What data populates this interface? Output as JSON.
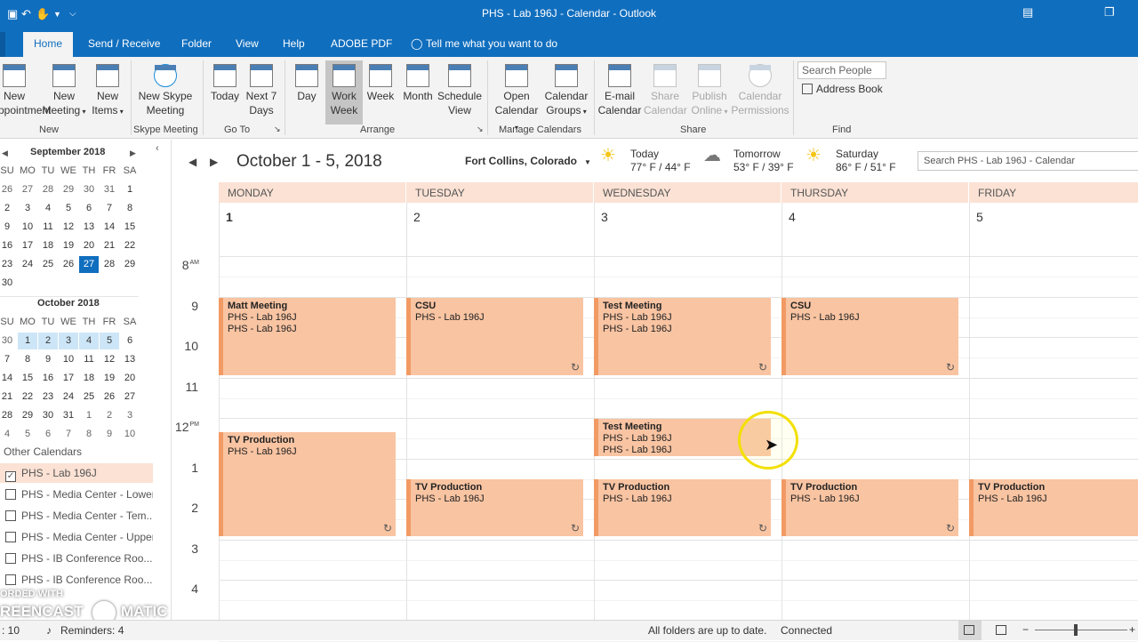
{
  "window": {
    "title": "PHS - Lab 196J - Calendar  -  Outlook"
  },
  "ribbon_tabs": [
    "Home",
    "Send / Receive",
    "Folder",
    "View",
    "Help",
    "ADOBE PDF"
  ],
  "tell_me": "Tell me what you want to do",
  "ribbon": {
    "new_appointment": [
      "New",
      "Appointment"
    ],
    "new_meeting": [
      "New",
      "Meeting"
    ],
    "new_items": [
      "New",
      "Items"
    ],
    "skype": [
      "New Skype",
      "Meeting"
    ],
    "today": "Today",
    "next7": [
      "Next 7",
      "Days"
    ],
    "day": "Day",
    "work_week": [
      "Work",
      "Week"
    ],
    "week": "Week",
    "month": "Month",
    "schedule": [
      "Schedule",
      "View"
    ],
    "open_calendar": [
      "Open",
      "Calendar"
    ],
    "calendar_groups": [
      "Calendar",
      "Groups"
    ],
    "email_calendar": [
      "E-mail",
      "Calendar"
    ],
    "share_calendar": [
      "Share",
      "Calendar"
    ],
    "publish_online": [
      "Publish",
      "Online"
    ],
    "calendar_permissions": [
      "Calendar",
      "Permissions"
    ],
    "search_people": "Search People",
    "address_book": "Address Book",
    "groups": {
      "new": "New",
      "skype": "Skype Meeting",
      "goto": "Go To",
      "arrange": "Arrange",
      "manage": "Manage Calendars",
      "share": "Share",
      "find": "Find"
    }
  },
  "mini_calendars": [
    {
      "title": "September 2018",
      "dow": [
        "SU",
        "MO",
        "TU",
        "WE",
        "TH",
        "FR",
        "SA"
      ],
      "weeks": [
        [
          "26",
          "27",
          "28",
          "29",
          "30",
          "31",
          "1"
        ],
        [
          "2",
          "3",
          "4",
          "5",
          "6",
          "7",
          "8"
        ],
        [
          "9",
          "10",
          "11",
          "12",
          "13",
          "14",
          "15"
        ],
        [
          "16",
          "17",
          "18",
          "19",
          "20",
          "21",
          "22"
        ],
        [
          "23",
          "24",
          "25",
          "26",
          "27",
          "28",
          "29"
        ],
        [
          "30"
        ]
      ]
    },
    {
      "title": "October 2018",
      "dow": [
        "SU",
        "MO",
        "TU",
        "WE",
        "TH",
        "FR",
        "SA"
      ],
      "weeks": [
        [
          "30",
          "1",
          "2",
          "3",
          "4",
          "5",
          "6"
        ],
        [
          "7",
          "8",
          "9",
          "10",
          "11",
          "12",
          "13"
        ],
        [
          "14",
          "15",
          "16",
          "17",
          "18",
          "19",
          "20"
        ],
        [
          "21",
          "22",
          "23",
          "24",
          "25",
          "26",
          "27"
        ],
        [
          "28",
          "29",
          "30",
          "31",
          "1",
          "2",
          "3"
        ],
        [
          "4",
          "5",
          "6",
          "7",
          "8",
          "9",
          "10"
        ]
      ]
    }
  ],
  "other_calendars": {
    "header": "Other Calendars",
    "items": [
      {
        "label": "PHS - Lab 196J",
        "checked": true
      },
      {
        "label": "PHS - Media Center - Lower",
        "checked": false
      },
      {
        "label": "PHS - Media Center - Tem...",
        "checked": false
      },
      {
        "label": "PHS - Media Center - Upper",
        "checked": false
      },
      {
        "label": "PHS - IB Conference Roo...",
        "checked": false
      },
      {
        "label": "PHS - IB Conference Roo...",
        "checked": false
      }
    ]
  },
  "watermark": {
    "line1": "ORDED WITH",
    "line2": "REENCAST",
    "line3": "MATIC"
  },
  "calendar_header": {
    "date_range": "October 1 - 5, 2018",
    "location": "Fort Collins, Colorado",
    "weather": [
      {
        "day": "Today",
        "temp": "77° F / 44° F",
        "icon": "sun-icon"
      },
      {
        "day": "Tomorrow",
        "temp": "53° F / 39° F",
        "icon": "cloud-icon"
      },
      {
        "day": "Saturday",
        "temp": "86° F / 51° F",
        "icon": "sun-icon"
      }
    ],
    "search_placeholder": "Search PHS - Lab 196J - Calendar"
  },
  "days": [
    {
      "name": "MONDAY",
      "num": "1"
    },
    {
      "name": "TUESDAY",
      "num": "2"
    },
    {
      "name": "WEDNESDAY",
      "num": "3"
    },
    {
      "name": "THURSDAY",
      "num": "4"
    },
    {
      "name": "FRIDAY",
      "num": "5"
    }
  ],
  "hours": [
    {
      "label": "8",
      "suffix": "AM"
    },
    {
      "label": "9",
      "suffix": ""
    },
    {
      "label": "10",
      "suffix": ""
    },
    {
      "label": "11",
      "suffix": ""
    },
    {
      "label": "12",
      "suffix": "PM"
    },
    {
      "label": "1",
      "suffix": ""
    },
    {
      "label": "2",
      "suffix": ""
    },
    {
      "label": "3",
      "suffix": ""
    },
    {
      "label": "4",
      "suffix": ""
    }
  ],
  "events": [
    {
      "day": 0,
      "start": 9,
      "end": 11,
      "subject": "Matt Meeting",
      "lines": [
        "PHS - Lab 196J",
        "PHS - Lab 196J"
      ],
      "recurring": false
    },
    {
      "day": 1,
      "start": 9,
      "end": 11,
      "subject": "CSU",
      "lines": [
        "PHS - Lab 196J"
      ],
      "recurring": true
    },
    {
      "day": 2,
      "start": 9,
      "end": 11,
      "subject": "Test Meeting",
      "lines": [
        "PHS - Lab 196J",
        "PHS - Lab 196J"
      ],
      "recurring": true
    },
    {
      "day": 3,
      "start": 9,
      "end": 11,
      "subject": "CSU",
      "lines": [
        "PHS - Lab 196J"
      ],
      "recurring": true
    },
    {
      "day": 0,
      "start": 12.33,
      "end": 15,
      "subject": "TV Production",
      "lines": [
        "PHS - Lab 196J"
      ],
      "recurring": true
    },
    {
      "day": 2,
      "start": 12,
      "end": 13,
      "subject": "Test Meeting",
      "lines": [
        "PHS - Lab 196J",
        "PHS - Lab 196J"
      ],
      "recurring": false
    },
    {
      "day": 1,
      "start": 13.5,
      "end": 15,
      "subject": "TV Production",
      "lines": [
        "PHS - Lab 196J"
      ],
      "recurring": true
    },
    {
      "day": 2,
      "start": 13.5,
      "end": 15,
      "subject": "TV Production",
      "lines": [
        "PHS - Lab 196J"
      ],
      "recurring": true
    },
    {
      "day": 3,
      "start": 13.5,
      "end": 15,
      "subject": "TV Production",
      "lines": [
        "PHS - Lab 196J"
      ],
      "recurring": true
    },
    {
      "day": 4,
      "start": 13.5,
      "end": 15,
      "subject": "TV Production",
      "lines": [
        "PHS - Lab 196J"
      ],
      "recurring": false
    }
  ],
  "status": {
    "items": ": 10",
    "reminders": "Reminders: 4",
    "sync": "All folders are up to date.",
    "connection": "Connected"
  },
  "colors": {
    "accent": "#106ebe",
    "event_fill": "#f9c4a2",
    "event_border": "#f29a64",
    "day_header": "#fbe2d4"
  }
}
